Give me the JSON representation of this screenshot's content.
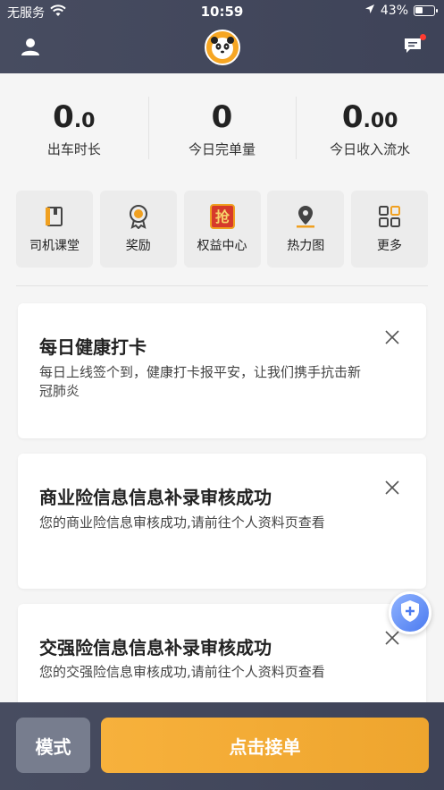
{
  "status_bar": {
    "carrier": "无服务",
    "time": "10:59",
    "battery": "43%",
    "battery_level": 0.43
  },
  "stats": [
    {
      "value_main": "0",
      "value_sub": ".0",
      "label": "出车时长"
    },
    {
      "value_main": "0",
      "value_sub": "",
      "label": "今日完单量"
    },
    {
      "value_main": "0",
      "value_sub": ".00",
      "label": "今日收入流水"
    }
  ],
  "quick_actions": [
    {
      "label": "司机课堂",
      "icon": "book-icon"
    },
    {
      "label": "奖励",
      "icon": "medal-icon"
    },
    {
      "label": "权益中心",
      "icon": "grab-badge-icon",
      "badge_text": "抢"
    },
    {
      "label": "热力图",
      "icon": "map-pin-icon"
    },
    {
      "label": "更多",
      "icon": "grid-icon"
    }
  ],
  "cards": [
    {
      "title": "每日健康打卡",
      "desc": "每日上线签个到，健康打卡报平安，让我们携手抗击新冠肺炎"
    },
    {
      "title": "商业险信息信息补录审核成功",
      "desc": "您的商业险信息审核成功,请前往个人资料页查看"
    },
    {
      "title": "交强险信息信息补录审核成功",
      "desc": "您的交强险信息审核成功,请前往个人资料页查看"
    }
  ],
  "bottom": {
    "mode_label": "模式",
    "accept_label": "点击接单"
  },
  "colors": {
    "header": "#474c60",
    "accent": "#f6a623",
    "fab": "#4c7bf0"
  }
}
